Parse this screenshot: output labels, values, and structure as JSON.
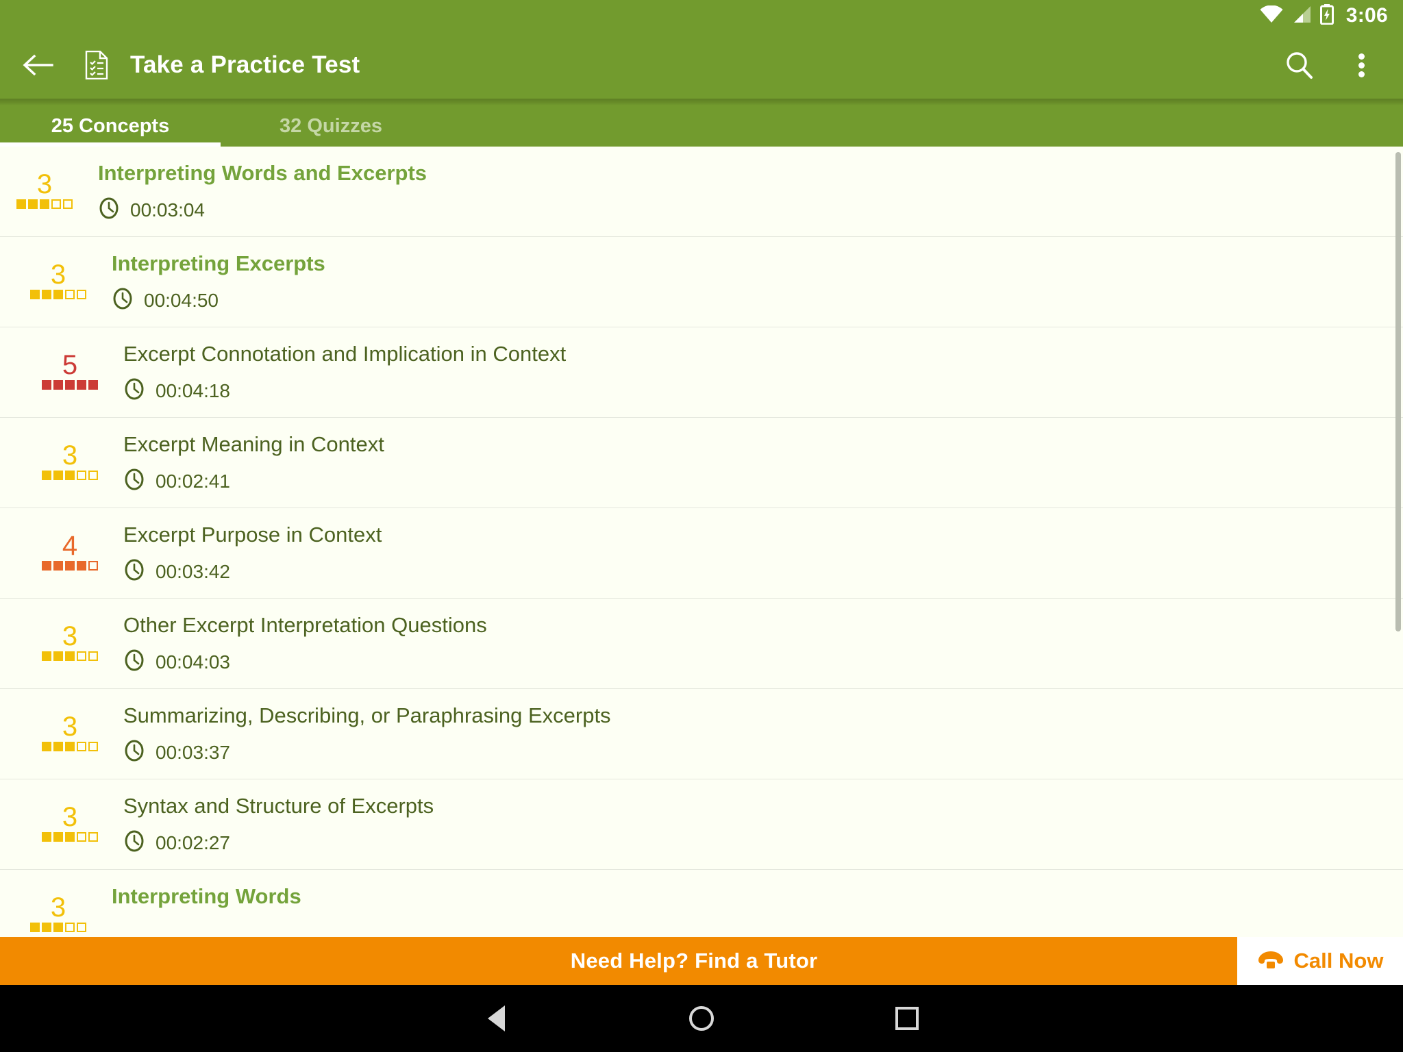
{
  "status_bar": {
    "time": "3:06",
    "icons": [
      "wifi-icon",
      "cellular-signal-icon",
      "battery-charging-icon"
    ]
  },
  "action_bar": {
    "back_icon": "arrow-back-icon",
    "doc_icon": "practice-test-document-icon",
    "title": "Take a Practice Test",
    "search_icon": "search-icon",
    "overflow_icon": "overflow-menu-icon"
  },
  "tabs": {
    "selected_index": 0,
    "items": [
      {
        "label": "25 Concepts"
      },
      {
        "label": "32 Quizzes"
      }
    ]
  },
  "list": {
    "rows": [
      {
        "difficulty": "3",
        "filled": 3,
        "total": 5,
        "color": "#f2c009",
        "title": "Interpreting Words and Excerpts",
        "time": "00:03:04",
        "indent": 105,
        "lead": true
      },
      {
        "difficulty": "3",
        "filled": 3,
        "total": 5,
        "color": "#f2c009",
        "title": "Interpreting Excerpts",
        "time": "00:04:50",
        "indent": 125,
        "lead": true
      },
      {
        "difficulty": "5",
        "filled": 5,
        "total": 5,
        "color": "#cc3b36",
        "title": "Excerpt Connotation and Implication in Context",
        "time": "00:04:18",
        "indent": 142,
        "lead": false
      },
      {
        "difficulty": "3",
        "filled": 3,
        "total": 5,
        "color": "#f2c009",
        "title": "Excerpt Meaning in Context",
        "time": "00:02:41",
        "indent": 142,
        "lead": false
      },
      {
        "difficulty": "4",
        "filled": 4,
        "total": 5,
        "color": "#e8692a",
        "title": "Excerpt Purpose in Context",
        "time": "00:03:42",
        "indent": 142,
        "lead": false
      },
      {
        "difficulty": "3",
        "filled": 3,
        "total": 5,
        "color": "#f2c009",
        "title": "Other Excerpt Interpretation Questions",
        "time": "00:04:03",
        "indent": 142,
        "lead": false
      },
      {
        "difficulty": "3",
        "filled": 3,
        "total": 5,
        "color": "#f2c009",
        "title": "Summarizing, Describing, or Paraphrasing Excerpts",
        "time": "00:03:37",
        "indent": 142,
        "lead": false
      },
      {
        "difficulty": "3",
        "filled": 3,
        "total": 5,
        "color": "#f2c009",
        "title": "Syntax and Structure of Excerpts",
        "time": "00:02:27",
        "indent": 142,
        "lead": false
      },
      {
        "difficulty": "3",
        "filled": 3,
        "total": 5,
        "color": "#f2c009",
        "title": "Interpreting Words",
        "time": "",
        "indent": 125,
        "lead": true
      }
    ],
    "clock_icon": "clock-icon"
  },
  "banner": {
    "text": "Need Help? Find a Tutor",
    "call_label": "Call Now",
    "call_icon": "phone-icon",
    "accent_color": "#f28a00"
  },
  "nav_bar": {
    "back_icon": "android-back-icon",
    "home_icon": "android-home-icon",
    "recents_icon": "android-recents-icon"
  },
  "colors": {
    "brand_green": "#729b2e",
    "title_green": "#74a33b",
    "text_olive": "#4c6220",
    "orange": "#f28a00"
  }
}
